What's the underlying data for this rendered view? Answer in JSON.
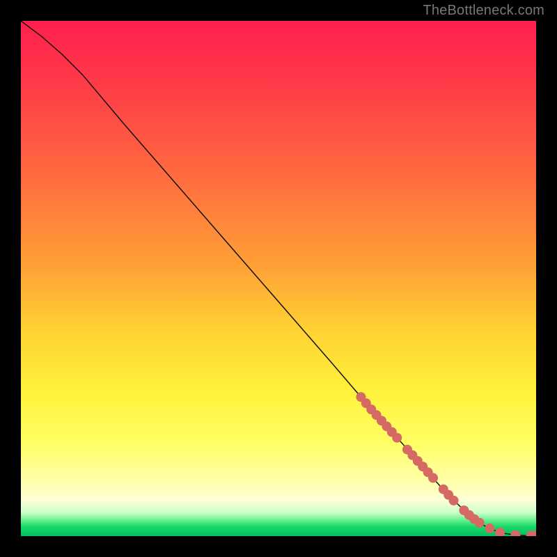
{
  "watermark": "TheBottleneck.com",
  "colors": {
    "dot": "#d46a63",
    "curve": "#111111"
  },
  "chart_data": {
    "type": "line",
    "title": "",
    "xlabel": "",
    "ylabel": "",
    "xlim": [
      0,
      100
    ],
    "ylim": [
      0,
      100
    ],
    "curve": {
      "x": [
        0,
        4,
        8,
        12,
        20,
        30,
        40,
        50,
        60,
        66,
        70,
        74,
        78,
        82,
        86,
        88,
        90,
        92,
        94,
        96,
        98,
        100
      ],
      "y": [
        100,
        97,
        93.5,
        89.5,
        80,
        68.5,
        57,
        45.5,
        34,
        27,
        22.5,
        18,
        13.5,
        9,
        5,
        3.3,
        2.0,
        1.1,
        0.5,
        0.2,
        0.1,
        0.1
      ]
    },
    "markers": {
      "x": [
        66,
        67,
        68,
        69,
        70,
        71,
        72,
        73,
        75,
        76,
        77,
        78,
        79,
        80,
        82,
        83,
        84,
        86,
        87,
        88,
        89,
        91,
        93,
        96,
        99,
        100
      ],
      "y": [
        27.0,
        25.8,
        24.6,
        23.5,
        22.4,
        21.3,
        20.2,
        19.1,
        16.8,
        15.7,
        14.6,
        13.5,
        12.4,
        11.3,
        9.1,
        8.0,
        6.9,
        5.0,
        4.1,
        3.3,
        2.6,
        1.5,
        0.7,
        0.2,
        0.1,
        0.1
      ],
      "r": 7
    }
  }
}
